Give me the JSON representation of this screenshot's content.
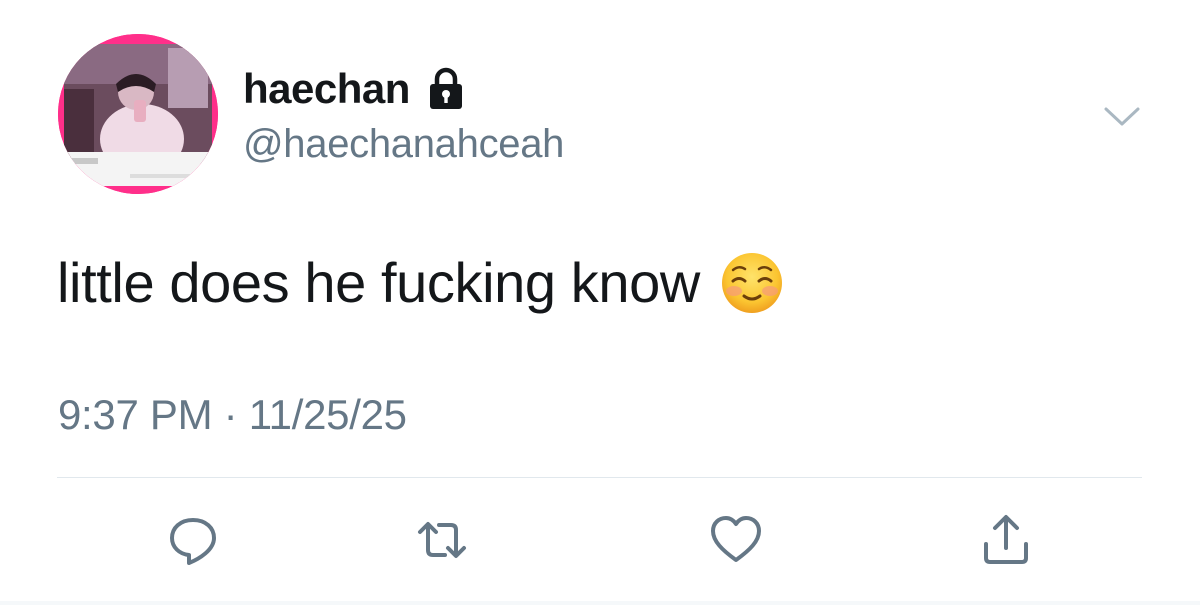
{
  "tweet": {
    "author": {
      "display_name": "haechan",
      "handle": "@haechanahceah",
      "protected": true,
      "avatar_icon": "profile-photo"
    },
    "text": "little does he fucking know",
    "emoji": "relieved-smiling-face-emoji",
    "timestamp": "9:37 PM · 11/25/25"
  },
  "icons": {
    "lock": "lock-icon",
    "caret": "chevron-down-icon",
    "reply": "reply-icon",
    "retweet": "retweet-icon",
    "like": "heart-icon",
    "share": "share-icon"
  },
  "colors": {
    "text_primary": "#14171a",
    "text_secondary": "#657786",
    "icon": "#657786",
    "divider": "#e1e8ed",
    "avatar_border": "#ff2f8a"
  }
}
